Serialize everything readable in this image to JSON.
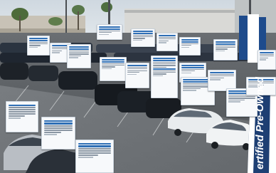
{
  "scene": {
    "subject": "car-dealership-lot",
    "sign_text": "ertified Pre-Owned",
    "colors": {
      "sky": "#dfe6ec",
      "asphalt": "#55595d",
      "sign_blue": "#1e3f73",
      "sign_white": "#ffffff",
      "card_link": "#2f6fb5",
      "card_bg": "#f7f9fb"
    }
  }
}
